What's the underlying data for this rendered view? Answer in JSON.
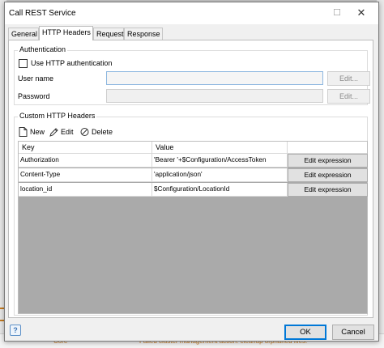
{
  "window": {
    "title": "Call REST Service"
  },
  "tabs": [
    {
      "label": "General"
    },
    {
      "label": "HTTP Headers"
    },
    {
      "label": "Request"
    },
    {
      "label": "Response"
    }
  ],
  "authentication": {
    "group_label": "Authentication",
    "use_http_auth_label": "Use HTTP authentication",
    "username_label": "User name",
    "password_label": "Password",
    "edit_label": "Edit..."
  },
  "custom_headers": {
    "group_label": "Custom HTTP Headers",
    "toolbar": {
      "new": "New",
      "edit": "Edit",
      "delete": "Delete"
    },
    "columns": [
      "Key",
      "Value"
    ],
    "edit_expression_label": "Edit expression",
    "rows": [
      {
        "key": "Authorization",
        "value": "'Bearer '+$Configuration/AccessToken"
      },
      {
        "key": "Content-Type",
        "value": "'application/json'"
      },
      {
        "key": "location_id",
        "value": "$Configuration/LocationId"
      }
    ]
  },
  "footer": {
    "help_label": "?",
    "ok_label": "OK",
    "cancel_label": "Cancel"
  },
  "background": {
    "status_left": "Core",
    "status_message": "Failed cluster management action: cleanup orphaned files."
  },
  "colors": {
    "accent": "#0078d7",
    "grid_empty": "#aaaaaa",
    "status_text": "#c47a1e"
  }
}
